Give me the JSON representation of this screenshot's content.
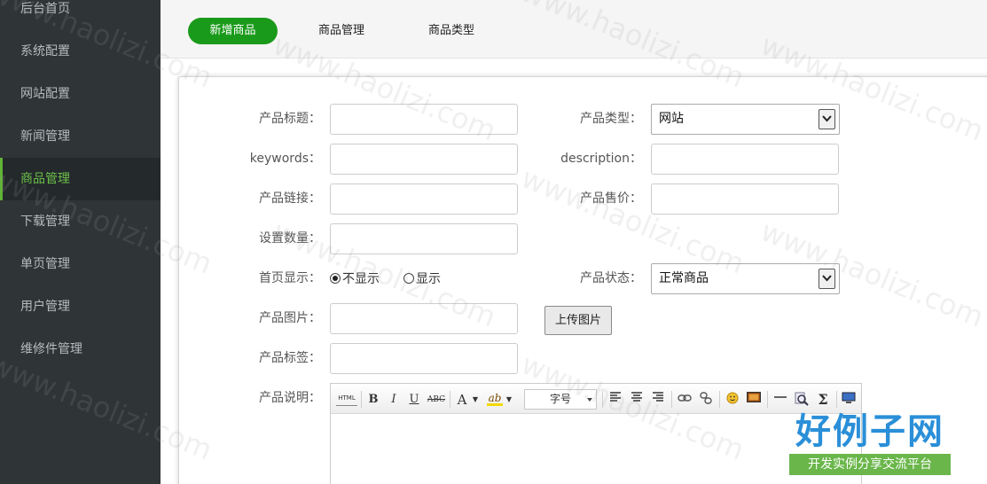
{
  "sidebar": {
    "items": [
      {
        "label": "后台首页"
      },
      {
        "label": "系统配置"
      },
      {
        "label": "网站配置"
      },
      {
        "label": "新闻管理"
      },
      {
        "label": "商品管理"
      },
      {
        "label": "下载管理"
      },
      {
        "label": "单页管理"
      },
      {
        "label": "用户管理"
      },
      {
        "label": "维修件管理"
      }
    ],
    "active": "商品管理"
  },
  "tabs": {
    "add": "新增商品",
    "manage": "商品管理",
    "types": "商品类型"
  },
  "form": {
    "title_label": "产品标题：",
    "type_label": "产品类型：",
    "type_value": "网站",
    "keywords_label": "keywords：",
    "description_label": "description：",
    "link_label": "产品链接：",
    "price_label": "产品售价：",
    "quantity_label": "设置数量：",
    "homepage_label": "首页显示：",
    "homepage_options": [
      "不显示",
      "显示"
    ],
    "homepage_selected": "不显示",
    "status_label": "产品状态：",
    "status_value": "正常商品",
    "image_label": "产品图片：",
    "upload_button": "上传图片",
    "tags_label": "产品标签：",
    "desc_label": "产品说明："
  },
  "editor": {
    "html_btn": "HTML",
    "bold": "B",
    "italic": "I",
    "underline": "U",
    "strike": "ABC",
    "font_color": "A",
    "highlight": "ab",
    "font_size": "字号",
    "formula": "Σ"
  },
  "watermark": "www.haolizi.com",
  "logo": {
    "main": "好例子网",
    "sub": "开发实例分享交流平台"
  },
  "colors": {
    "sidebar_bg": "#2f3437",
    "active_text": "#6cc04a",
    "primary_button": "#1a9a1a",
    "logo_blue": "#2a8fd8",
    "logo_green": "#6ab64a"
  }
}
